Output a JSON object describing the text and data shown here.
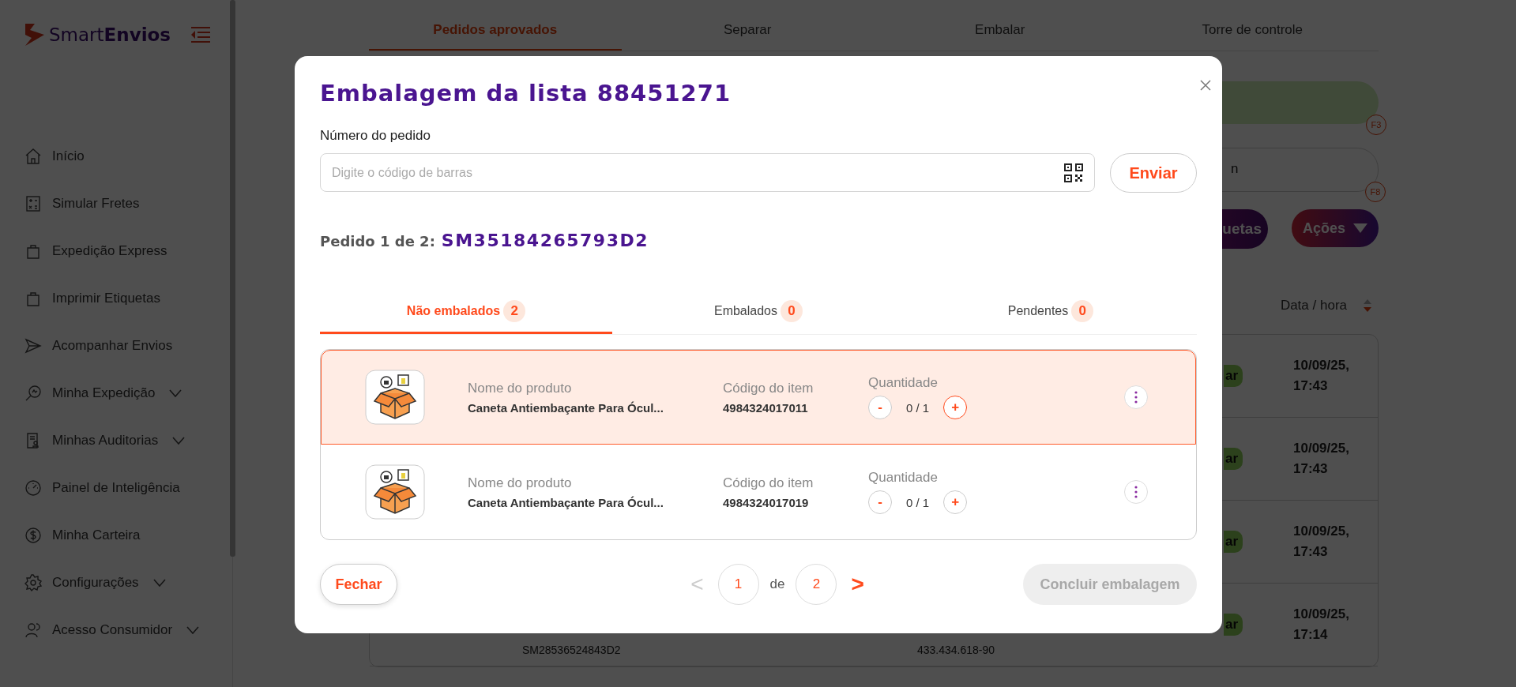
{
  "sidebar": {
    "logo": {
      "light": "Smart",
      "bold": "Envios"
    },
    "items": [
      {
        "label": "Início",
        "submenu": false
      },
      {
        "label": "Simular Fretes",
        "submenu": false
      },
      {
        "label": "Expedição Express",
        "submenu": false
      },
      {
        "label": "Imprimir Etiquetas",
        "submenu": false
      },
      {
        "label": "Acompanhar Envios",
        "submenu": false
      },
      {
        "label": "Minha Expedição",
        "submenu": true
      },
      {
        "label": "Minhas Auditorias",
        "submenu": true
      },
      {
        "label": "Painel de Inteligência",
        "submenu": false
      },
      {
        "label": "Minha Carteira",
        "submenu": false
      },
      {
        "label": "Configurações",
        "submenu": true
      },
      {
        "label": "Acesso Consumidor",
        "submenu": true
      }
    ]
  },
  "main": {
    "tabs": [
      {
        "label": "Pedidos aprovados",
        "selected": true
      },
      {
        "label": "Separar",
        "selected": false
      },
      {
        "label": "Embalar",
        "selected": false
      },
      {
        "label": "Torre de controle",
        "selected": false
      }
    ],
    "scan_bar": {
      "shortcut": "F3"
    },
    "search_field": {
      "value": "n",
      "shortcut": "F8"
    },
    "labels_button": "uetas",
    "actions_button": "Ações",
    "date_header": "Data / hora",
    "rows": [
      {
        "status": "ar",
        "date": "10/09/25,\n17:43"
      },
      {
        "status": "ar",
        "date": "10/09/25,\n17:43"
      },
      {
        "status": "ar",
        "date": "10/09/25,\n17:43"
      },
      {
        "code": "SM28536524843D2",
        "document": "433.434.618-90",
        "status": "ar",
        "date": "10/09/25,\n17:14"
      }
    ]
  },
  "modal": {
    "title": "Embalagem da lista 88451271",
    "field_label": "Número do pedido",
    "field": {
      "placeholder": "Digite o código de barras"
    },
    "send_button": "Enviar",
    "order": {
      "prefix": "Pedido 1 de 2:",
      "code": "SM35184265793D2"
    },
    "tabs": [
      {
        "label": "Não embalados",
        "count": "2",
        "selected": true
      },
      {
        "label": "Embalados",
        "count": "0",
        "selected": false
      },
      {
        "label": "Pendentes",
        "count": "0",
        "selected": false
      }
    ],
    "items": [
      {
        "name_label": "Nome do produto",
        "name": "Caneta Antiembaçante Para Ócul...",
        "code_label": "Código do item",
        "code": "4984324017011",
        "qty_label": "Quantidade",
        "minus": "-",
        "qty": "0 / 1",
        "plus": "+",
        "selected": true
      },
      {
        "name_label": "Nome do produto",
        "name": "Caneta Antiembaçante Para Ócul...",
        "code_label": "Código do item",
        "code": "4984324017019",
        "qty_label": "Quantidade",
        "minus": "-",
        "qty": "0 / 1",
        "plus": "+",
        "selected": false
      }
    ],
    "close_button": "Fechar",
    "pager": {
      "prev": "<",
      "prev_disabled": true,
      "current": "1",
      "of": "de",
      "total": "2",
      "next": ">",
      "next_disabled": false
    },
    "finish_button": {
      "label": "Concluir embalagem",
      "disabled": true
    }
  }
}
